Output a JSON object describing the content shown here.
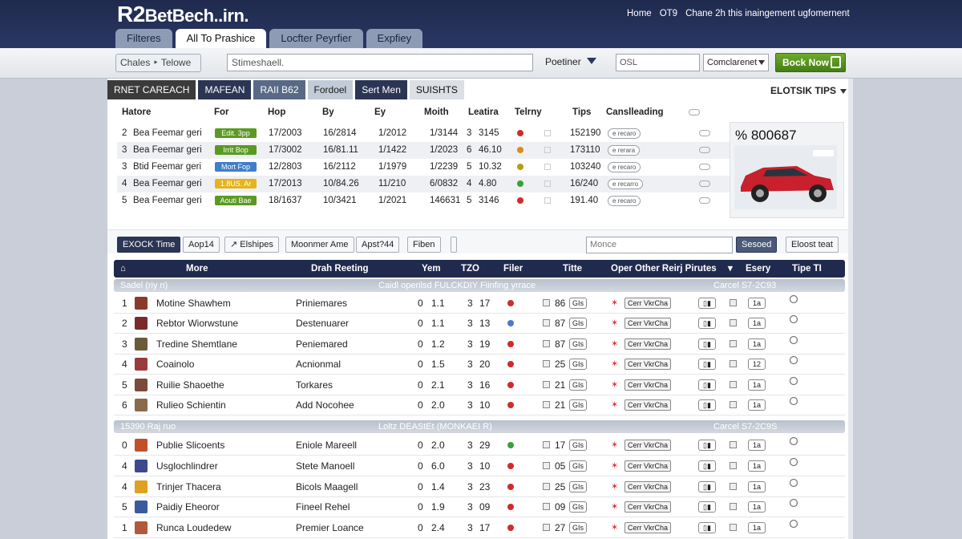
{
  "header": {
    "logo_big": "R2",
    "logo_rest": "BetBech..irn.",
    "nav": [
      "Home",
      "OT9",
      "Chane 2h this inaingement ugfomernent"
    ],
    "tabs": [
      "Filteres",
      "All To Prashice",
      "Locfter Peyrfier",
      "Expfiey"
    ],
    "active_tab": 1
  },
  "searchbar": {
    "filter_button": "Chales ‣ Telowe",
    "search_value": "Stimeshaell.",
    "partner_label": "Poetiner",
    "small_input": "OSL",
    "select_value": "Comclarenet",
    "book_button": "Bock Now"
  },
  "content_tabs": [
    "RNET CAREACH",
    "MAFEAN",
    "RAII B62",
    "Fordoel",
    "Sert Men",
    "SUISHTS"
  ],
  "tips_label": "ELOTSIK TIPS",
  "top_table": {
    "headers": [
      "Hatore",
      "For",
      "Hop",
      "By",
      "Ey",
      "Moith",
      "Leatira",
      "Telrny",
      "Tips",
      "Canslleading"
    ],
    "rows": [
      {
        "n": "2",
        "name": "Bea Feemar geri",
        "tag": "Edit. 3pp",
        "tag_color": "#5a9a22",
        "a": "17/2003",
        "b": "16/2814",
        "c": "1/2012",
        "d": "1/3144",
        "e": "3",
        "f": "3145",
        "dot": "#d12b2b",
        "tips": "152190",
        "pill": "e recaro"
      },
      {
        "n": "3",
        "name": "Bea Feemar geri",
        "tag": "Irrit Bop",
        "tag_color": "#5a9a22",
        "a": "17/3002",
        "b": "16/81.11",
        "c": "1/1422",
        "d": "1/2023",
        "e": "6",
        "f": "46.10",
        "dot": "#d98b1a",
        "tips": "173110",
        "pill": "e rerara"
      },
      {
        "n": "3",
        "name": "Btid Feemar geri",
        "tag": "Mort Fop",
        "tag_color": "#3f7fc9",
        "a": "12/2803",
        "b": "16/2112",
        "c": "1/1979",
        "d": "1/2239",
        "e": "5",
        "f": "10.32",
        "dot": "#b89a1a",
        "tips": "103240",
        "pill": "e recaro"
      },
      {
        "n": "4",
        "name": "Bea Feemar geri",
        "tag": "1.8US. Ar",
        "tag_color": "#e5b41a",
        "a": "17/2013",
        "b": "10/84.26",
        "c": "11/210",
        "d": "6/0832",
        "e": "4",
        "f": "4.80",
        "dot": "#3aa13a",
        "tips": "16/240",
        "pill": "e recarro"
      },
      {
        "n": "5",
        "name": "Bea Feemar geri",
        "tag": "Aouti Bae",
        "tag_color": "#5a9a22",
        "a": "18/1637",
        "b": "10/3421",
        "c": "1/2021",
        "d": "146631",
        "e": "5",
        "f": "3146",
        "dot": "#d12b2b",
        "tips": "191.40",
        "pill": "e recaro"
      }
    ]
  },
  "feature": {
    "price": "% 800687"
  },
  "toolbar2": {
    "buttons": [
      "EXOCK Time",
      "Aop14",
      "↗ Elshipes",
      "Moonmer Ame",
      "Apst?44",
      "Fiben"
    ],
    "input_placeholder": "Monce",
    "search_button": "Sesoed",
    "reset_button": "Eloost teat"
  },
  "main_table": {
    "headers": [
      "More",
      "Drah Reeting",
      "Yem",
      "TZO",
      "Filer",
      "Titte",
      "Oper Other Reirj Pirutes",
      "Esery",
      "Tipe TI"
    ],
    "groups": [
      {
        "left": "Sadel (riy n)",
        "center": "Caidl operilsd FULCKDIY Fiinfing yrrace",
        "right": "Carcel S7-2C93"
      },
      {
        "left": "15390 Raj ruo",
        "center": "Loltz DEAStEt (MONKAEI R)",
        "right": "Carcel S7-2C9S"
      }
    ],
    "rows": [
      {
        "n": "1",
        "name": "Motine Shawhem",
        "team": "Priniemares",
        "y": "0",
        "v": "1.1",
        "t": "3",
        "f": "17",
        "dot": "#d12b2b",
        "cnt": "86",
        "badge": "GIs",
        "count": "1a"
      },
      {
        "n": "2",
        "name": "Rebtor Wiorwstune",
        "team": "Destenuarer",
        "y": "0",
        "v": "1.1",
        "t": "3",
        "f": "13",
        "dot": "#4a7ac9",
        "cnt": "87",
        "badge": "GIs",
        "count": "1a"
      },
      {
        "n": "3",
        "name": "Tredine Shemtlane",
        "team": "Peniemared",
        "y": "0",
        "v": "1.2",
        "t": "3",
        "f": "19",
        "dot": "#d12b2b",
        "cnt": "87",
        "badge": "GIs",
        "count": "1a"
      },
      {
        "n": "4",
        "name": "Coainolo",
        "team": "Acnionmal",
        "y": "0",
        "v": "1.5",
        "t": "3",
        "f": "20",
        "dot": "#d12b2b",
        "cnt": "25",
        "badge": "GIs",
        "count": "12"
      },
      {
        "n": "5",
        "name": "Ruilie Shaoethe",
        "team": "Torkares",
        "y": "0",
        "v": "2.1",
        "t": "3",
        "f": "16",
        "dot": "#d12b2b",
        "cnt": "21",
        "badge": "GIs",
        "count": "1a"
      },
      {
        "n": "6",
        "name": "Rulieo Schientin",
        "team": "Add Nocohee",
        "y": "0",
        "v": "2.0",
        "t": "3",
        "f": "10",
        "dot": "#d12b2b",
        "cnt": "21",
        "badge": "GIs",
        "count": "1a"
      },
      {
        "n": "0",
        "name": "Publie Slicoents",
        "team": "Eniole Mareell",
        "y": "0",
        "v": "2.0",
        "t": "3",
        "f": "29",
        "dot": "#3aa13a",
        "cnt": "17",
        "badge": "GIs",
        "count": "1a"
      },
      {
        "n": "4",
        "name": "Usglochlindrer",
        "team": "Stete Manoell",
        "y": "0",
        "v": "6.0",
        "t": "3",
        "f": "10",
        "dot": "#d12b2b",
        "cnt": "05",
        "badge": "GIs",
        "count": "1a"
      },
      {
        "n": "4",
        "name": "Trinjer Thacera",
        "team": "Bicols Maagell",
        "y": "0",
        "v": "1.4",
        "t": "3",
        "f": "23",
        "dot": "#d12b2b",
        "cnt": "25",
        "badge": "GIs",
        "count": "1a"
      },
      {
        "n": "5",
        "name": "Paidiy Eheoror",
        "team": "Fineel Rehel",
        "y": "0",
        "v": "1.9",
        "t": "3",
        "f": "09",
        "dot": "#d12b2b",
        "cnt": "09",
        "badge": "GIs",
        "count": "1a"
      },
      {
        "n": "1",
        "name": "Runca Loudedew",
        "team": "Premier Loance",
        "y": "0",
        "v": "2.4",
        "t": "3",
        "f": "17",
        "dot": "#d12b2b",
        "cnt": "27",
        "badge": "GIs",
        "count": "1a"
      }
    ],
    "row_pill": "Cerr VkrCha",
    "avatar_colors": [
      "#8a3a2a",
      "#7a2a2a",
      "#6a5a3a",
      "#9a3a3a",
      "#7a4a3a",
      "#8a6a4a",
      "#c2502a",
      "#3a4a8a",
      "#e0a020",
      "#3a5aa0",
      "#b05a3a"
    ]
  }
}
